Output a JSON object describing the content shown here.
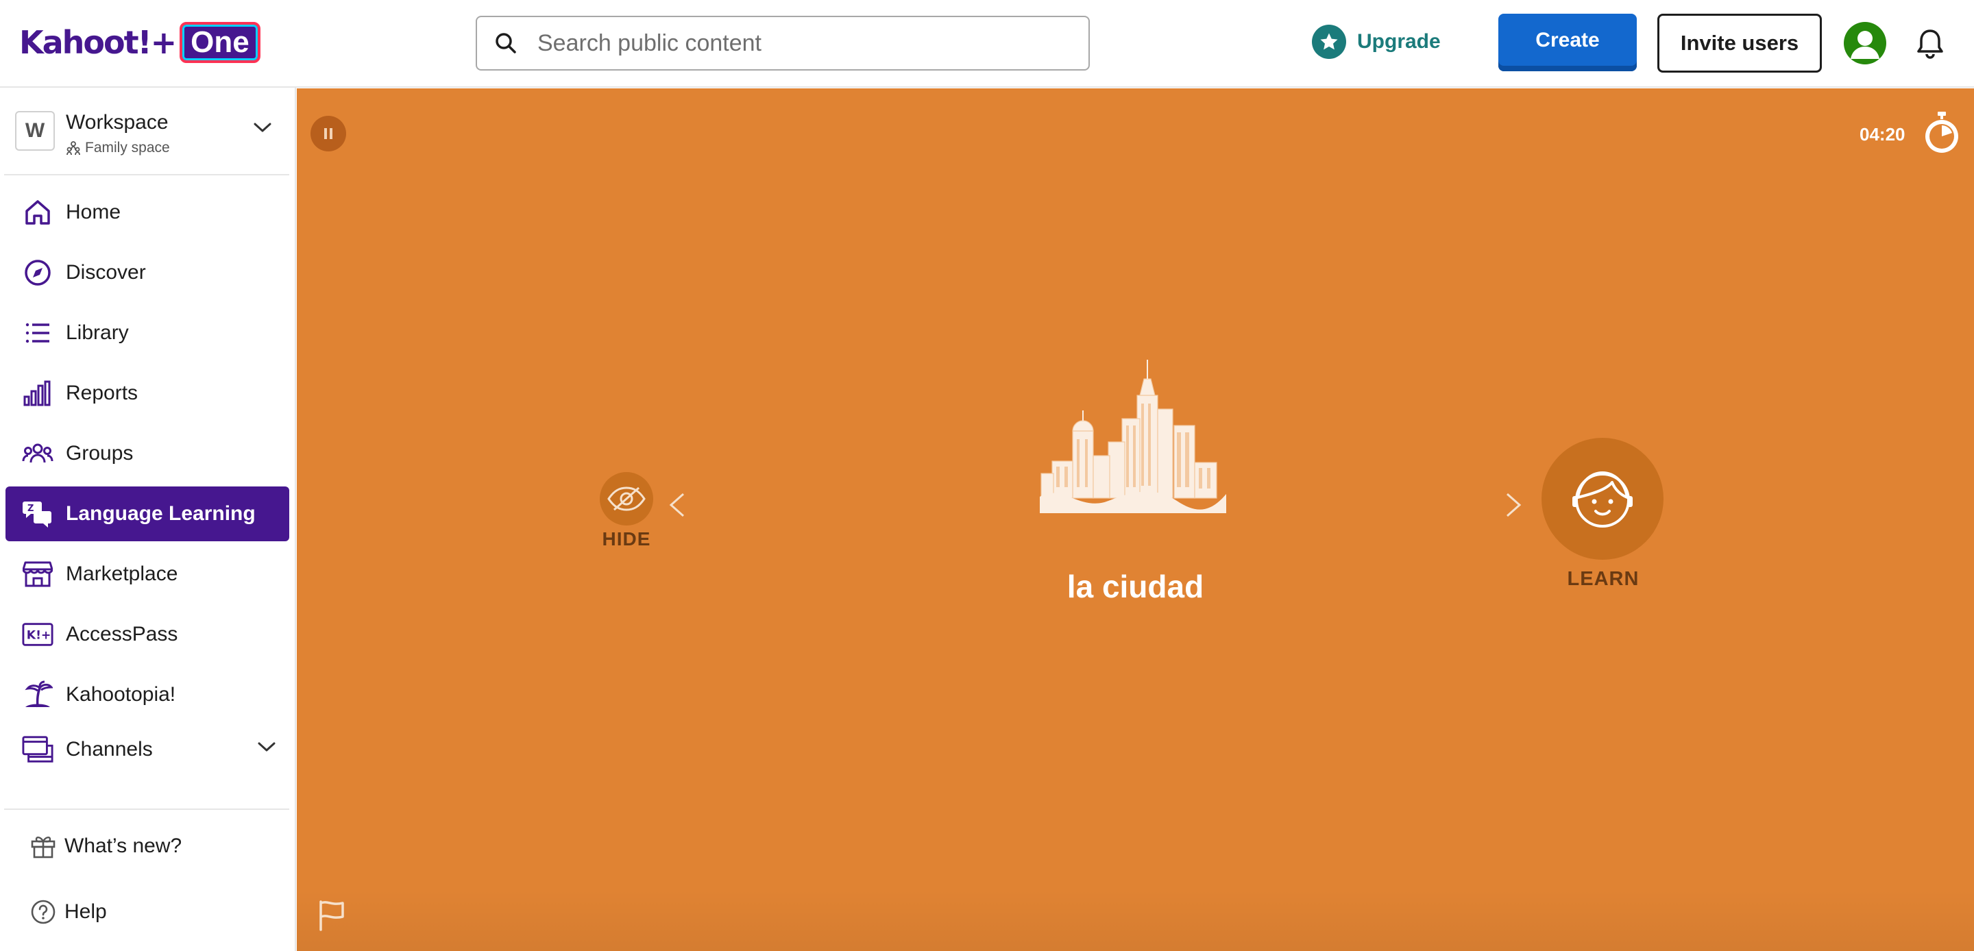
{
  "header": {
    "logo_text": "Kahoot!+",
    "logo_badge": "One",
    "search_placeholder": "Search public content",
    "upgrade_label": "Upgrade",
    "create_label": "Create",
    "invite_label": "Invite users",
    "avatar_icon": "user-avatar-icon",
    "bell_icon": "bell-icon"
  },
  "sidebar": {
    "workspace": {
      "badge": "W",
      "name": "Workspace",
      "subtitle": "Family space"
    },
    "items": [
      {
        "label": "Home",
        "icon": "home-icon"
      },
      {
        "label": "Discover",
        "icon": "compass-icon"
      },
      {
        "label": "Library",
        "icon": "list-icon"
      },
      {
        "label": "Reports",
        "icon": "bar-chart-icon"
      },
      {
        "label": "Groups",
        "icon": "group-icon"
      },
      {
        "label": "Language Learning",
        "icon": "language-icon",
        "active": true
      },
      {
        "label": "Marketplace",
        "icon": "store-icon"
      },
      {
        "label": "AccessPass",
        "icon": "accesspass-icon"
      },
      {
        "label": "Kahootopia!",
        "icon": "island-icon"
      },
      {
        "label": "Channels",
        "icon": "channels-icon"
      }
    ],
    "footer": [
      {
        "label": "What’s new?",
        "icon": "gift-icon"
      },
      {
        "label": "Help",
        "icon": "help-icon"
      }
    ]
  },
  "flashcard": {
    "timer": "04:20",
    "word": "la ciudad",
    "image": "city-skyline-illustration",
    "hide_label": "HIDE",
    "learn_label": "LEARN"
  },
  "colors": {
    "brand_purple": "#46178f",
    "create_blue": "#1368ce",
    "upgrade_teal": "#1b7b7b",
    "stage_orange": "#e08333",
    "avatar_green": "#26890c"
  }
}
